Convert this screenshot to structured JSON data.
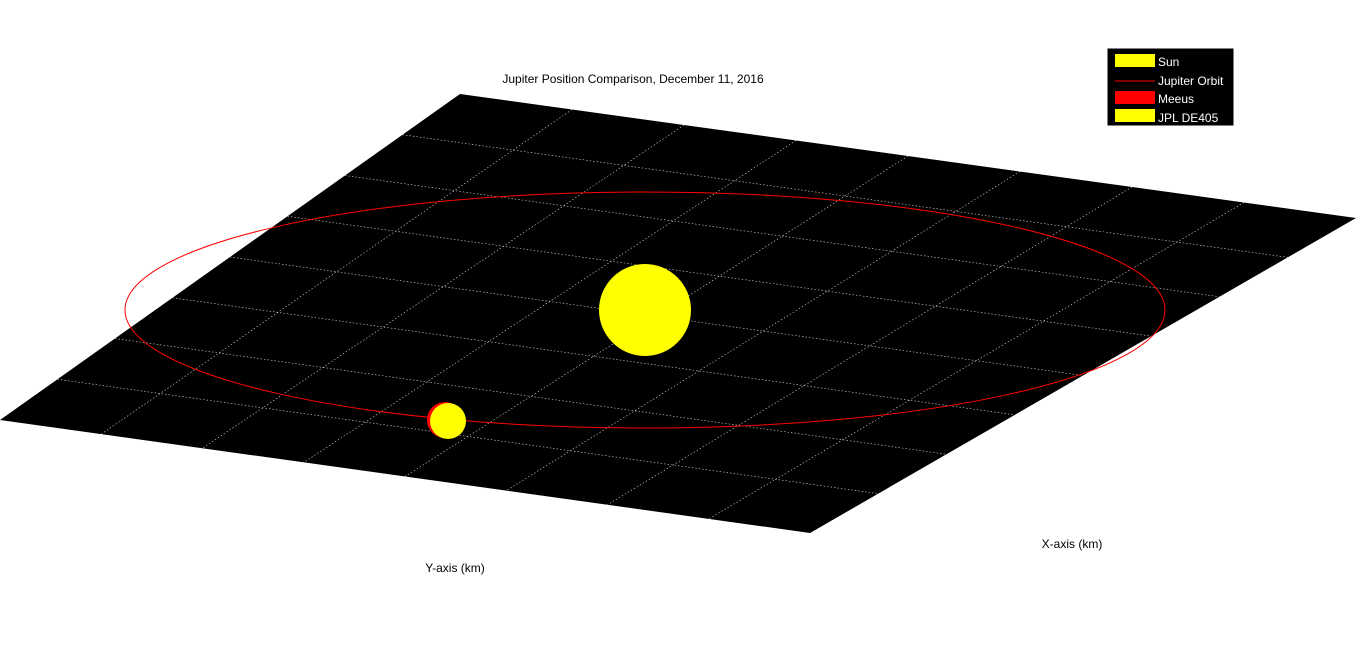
{
  "chart_data": {
    "type": "scatter",
    "title": "Jupiter Position Comparison, December 11, 2016",
    "xlabel": "X-axis (km)",
    "ylabel": "Y-axis (km)",
    "grid": true,
    "legend_placement": "top-right",
    "background_color": "#000000",
    "grid_color": "#ffffff",
    "series": [
      {
        "name": "Sun",
        "marker": "sphere",
        "color": "#ffff00"
      },
      {
        "name": "Jupiter Orbit",
        "marker": "line",
        "color": "#ff0000"
      },
      {
        "name": "Meeus",
        "marker": "sphere",
        "color": "#ff0000"
      },
      {
        "name": "JPL DE405",
        "marker": "sphere",
        "color": "#ffff00"
      }
    ]
  }
}
